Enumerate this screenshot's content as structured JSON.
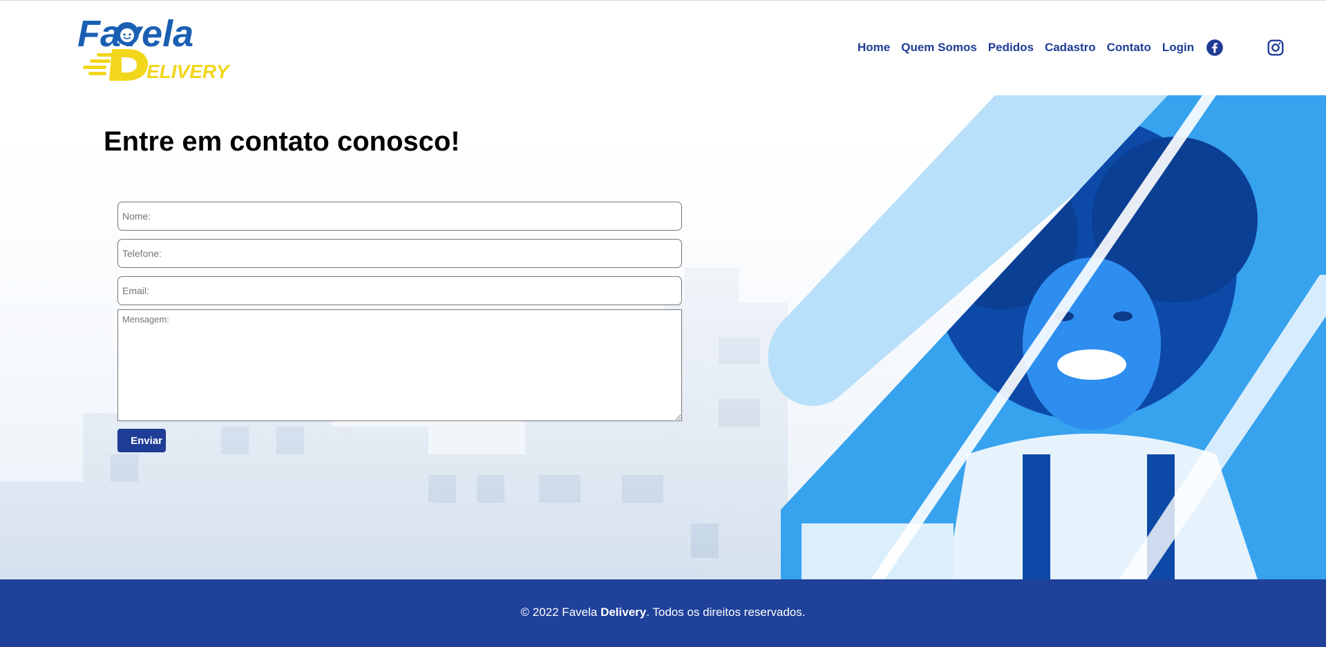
{
  "brand": {
    "logo_word": "Favela",
    "logo_sub": "DELIVERY",
    "primary_color": "#1f3c96",
    "accent_color": "#f2d61c"
  },
  "nav": {
    "items": [
      "Home",
      "Quem Somos",
      "Pedidos",
      "Cadastro",
      "Contato",
      "Login"
    ],
    "social": [
      "facebook-icon",
      "instagram-icon"
    ]
  },
  "contact": {
    "title": "Entre em contato conosco!",
    "name_placeholder": "Nome:",
    "phone_placeholder": "Telefone:",
    "email_placeholder": "Email:",
    "message_placeholder": "Mensagem:",
    "submit_label": "Enviar"
  },
  "footer": {
    "prefix": "© 2022 Favela ",
    "brand_bold": "Delivery",
    "suffix": ". Todos os direitos reservados."
  }
}
